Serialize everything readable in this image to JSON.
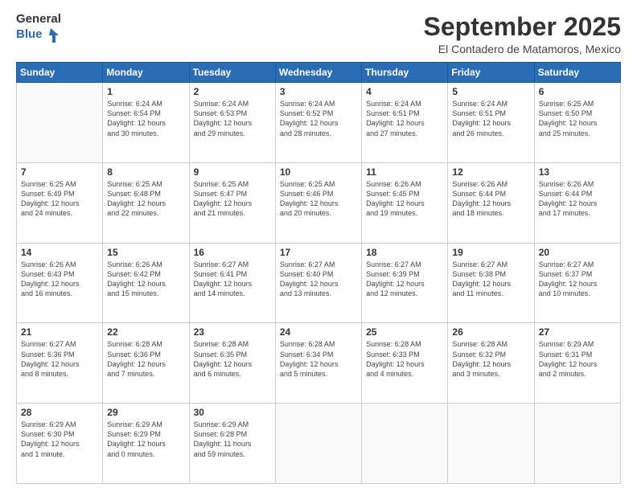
{
  "logo": {
    "general": "General",
    "blue": "Blue"
  },
  "header": {
    "month": "September 2025",
    "location": "El Contadero de Matamoros, Mexico"
  },
  "days_of_week": [
    "Sunday",
    "Monday",
    "Tuesday",
    "Wednesday",
    "Thursday",
    "Friday",
    "Saturday"
  ],
  "weeks": [
    [
      {
        "day": "",
        "info": ""
      },
      {
        "day": "1",
        "info": "Sunrise: 6:24 AM\nSunset: 6:54 PM\nDaylight: 12 hours\nand 30 minutes."
      },
      {
        "day": "2",
        "info": "Sunrise: 6:24 AM\nSunset: 6:53 PM\nDaylight: 12 hours\nand 29 minutes."
      },
      {
        "day": "3",
        "info": "Sunrise: 6:24 AM\nSunset: 6:52 PM\nDaylight: 12 hours\nand 28 minutes."
      },
      {
        "day": "4",
        "info": "Sunrise: 6:24 AM\nSunset: 6:51 PM\nDaylight: 12 hours\nand 27 minutes."
      },
      {
        "day": "5",
        "info": "Sunrise: 6:24 AM\nSunset: 6:51 PM\nDaylight: 12 hours\nand 26 minutes."
      },
      {
        "day": "6",
        "info": "Sunrise: 6:25 AM\nSunset: 6:50 PM\nDaylight: 12 hours\nand 25 minutes."
      }
    ],
    [
      {
        "day": "7",
        "info": "Sunrise: 6:25 AM\nSunset: 6:49 PM\nDaylight: 12 hours\nand 24 minutes."
      },
      {
        "day": "8",
        "info": "Sunrise: 6:25 AM\nSunset: 6:48 PM\nDaylight: 12 hours\nand 22 minutes."
      },
      {
        "day": "9",
        "info": "Sunrise: 6:25 AM\nSunset: 6:47 PM\nDaylight: 12 hours\nand 21 minutes."
      },
      {
        "day": "10",
        "info": "Sunrise: 6:25 AM\nSunset: 6:46 PM\nDaylight: 12 hours\nand 20 minutes."
      },
      {
        "day": "11",
        "info": "Sunrise: 6:26 AM\nSunset: 6:45 PM\nDaylight: 12 hours\nand 19 minutes."
      },
      {
        "day": "12",
        "info": "Sunrise: 6:26 AM\nSunset: 6:44 PM\nDaylight: 12 hours\nand 18 minutes."
      },
      {
        "day": "13",
        "info": "Sunrise: 6:26 AM\nSunset: 6:44 PM\nDaylight: 12 hours\nand 17 minutes."
      }
    ],
    [
      {
        "day": "14",
        "info": "Sunrise: 6:26 AM\nSunset: 6:43 PM\nDaylight: 12 hours\nand 16 minutes."
      },
      {
        "day": "15",
        "info": "Sunrise: 6:26 AM\nSunset: 6:42 PM\nDaylight: 12 hours\nand 15 minutes."
      },
      {
        "day": "16",
        "info": "Sunrise: 6:27 AM\nSunset: 6:41 PM\nDaylight: 12 hours\nand 14 minutes."
      },
      {
        "day": "17",
        "info": "Sunrise: 6:27 AM\nSunset: 6:40 PM\nDaylight: 12 hours\nand 13 minutes."
      },
      {
        "day": "18",
        "info": "Sunrise: 6:27 AM\nSunset: 6:39 PM\nDaylight: 12 hours\nand 12 minutes."
      },
      {
        "day": "19",
        "info": "Sunrise: 6:27 AM\nSunset: 6:38 PM\nDaylight: 12 hours\nand 11 minutes."
      },
      {
        "day": "20",
        "info": "Sunrise: 6:27 AM\nSunset: 6:37 PM\nDaylight: 12 hours\nand 10 minutes."
      }
    ],
    [
      {
        "day": "21",
        "info": "Sunrise: 6:27 AM\nSunset: 6:36 PM\nDaylight: 12 hours\nand 8 minutes."
      },
      {
        "day": "22",
        "info": "Sunrise: 6:28 AM\nSunset: 6:36 PM\nDaylight: 12 hours\nand 7 minutes."
      },
      {
        "day": "23",
        "info": "Sunrise: 6:28 AM\nSunset: 6:35 PM\nDaylight: 12 hours\nand 6 minutes."
      },
      {
        "day": "24",
        "info": "Sunrise: 6:28 AM\nSunset: 6:34 PM\nDaylight: 12 hours\nand 5 minutes."
      },
      {
        "day": "25",
        "info": "Sunrise: 6:28 AM\nSunset: 6:33 PM\nDaylight: 12 hours\nand 4 minutes."
      },
      {
        "day": "26",
        "info": "Sunrise: 6:28 AM\nSunset: 6:32 PM\nDaylight: 12 hours\nand 3 minutes."
      },
      {
        "day": "27",
        "info": "Sunrise: 6:29 AM\nSunset: 6:31 PM\nDaylight: 12 hours\nand 2 minutes."
      }
    ],
    [
      {
        "day": "28",
        "info": "Sunrise: 6:29 AM\nSunset: 6:30 PM\nDaylight: 12 hours\nand 1 minute."
      },
      {
        "day": "29",
        "info": "Sunrise: 6:29 AM\nSunset: 6:29 PM\nDaylight: 12 hours\nand 0 minutes."
      },
      {
        "day": "30",
        "info": "Sunrise: 6:29 AM\nSunset: 6:28 PM\nDaylight: 11 hours\nand 59 minutes."
      },
      {
        "day": "",
        "info": ""
      },
      {
        "day": "",
        "info": ""
      },
      {
        "day": "",
        "info": ""
      },
      {
        "day": "",
        "info": ""
      }
    ]
  ]
}
